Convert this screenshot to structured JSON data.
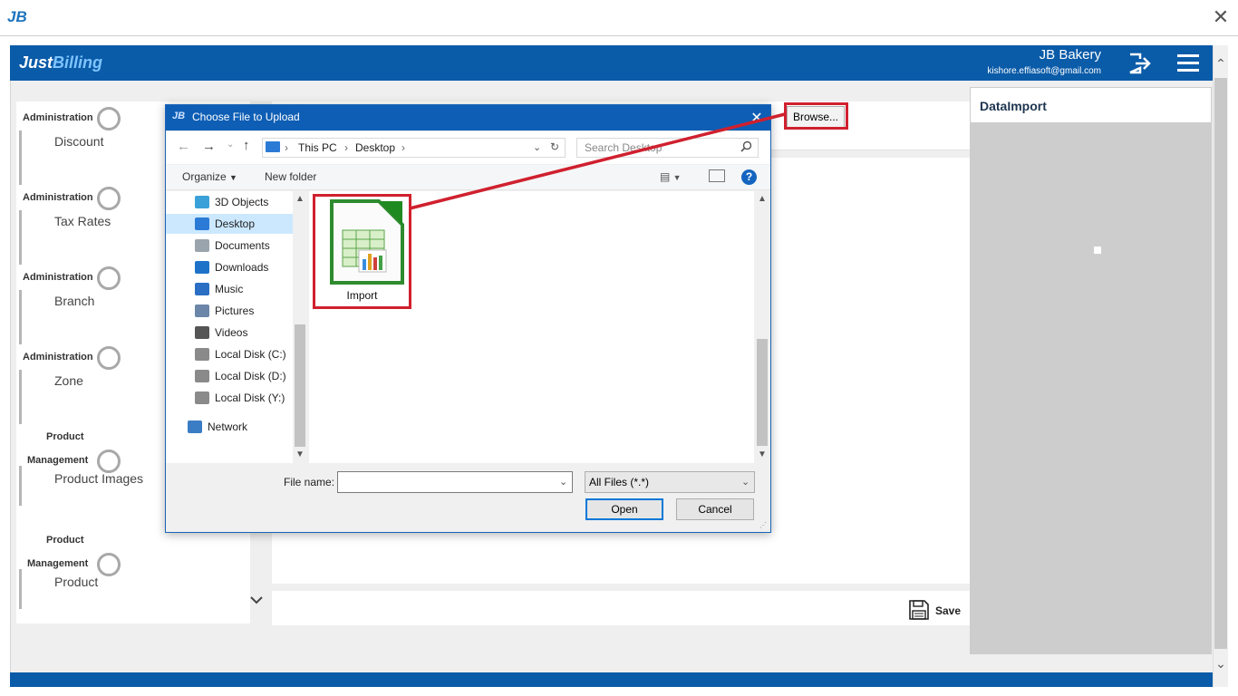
{
  "window": {
    "logo_text": "JB",
    "close_glyph": "✕"
  },
  "header": {
    "brand_part1": "Just",
    "brand_part2": "Billing",
    "company": "JB Bakery",
    "email": "kishore.effiasoft@gmail.com",
    "logout_icon": "logout-icon",
    "menu_icon": "hamburger-menu-icon"
  },
  "sidebar": {
    "items": [
      {
        "category_lines": [
          "Administration"
        ],
        "label": "Discount"
      },
      {
        "category_lines": [
          "Administration"
        ],
        "label": "Tax Rates"
      },
      {
        "category_lines": [
          "Administration"
        ],
        "label": "Branch"
      },
      {
        "category_lines": [
          "Administration"
        ],
        "label": "Zone"
      },
      {
        "category_lines": [
          "Product",
          "Management"
        ],
        "label": "Product Images"
      },
      {
        "category_lines": [
          "Product",
          "Management"
        ],
        "label": "Product"
      }
    ]
  },
  "main": {
    "browse_label": "Browse...",
    "save_label": "Save"
  },
  "right_panel": {
    "title": "DataImport"
  },
  "dialog": {
    "title": "Choose File to Upload",
    "breadcrumb": [
      "This PC",
      "Desktop"
    ],
    "search_placeholder": "Search Desktop",
    "organize_label": "Organize",
    "new_folder_label": "New folder",
    "nav_items": [
      {
        "label": "3D Objects",
        "icon": "3d-objects-icon",
        "color": "#3aa0d8"
      },
      {
        "label": "Desktop",
        "icon": "desktop-icon",
        "color": "#2b7bd6"
      },
      {
        "label": "Documents",
        "icon": "documents-icon",
        "color": "#9aa4ad"
      },
      {
        "label": "Downloads",
        "icon": "downloads-icon",
        "color": "#1e73c9"
      },
      {
        "label": "Music",
        "icon": "music-icon",
        "color": "#2a6fc4"
      },
      {
        "label": "Pictures",
        "icon": "pictures-icon",
        "color": "#6b86a8"
      },
      {
        "label": "Videos",
        "icon": "videos-icon",
        "color": "#555555"
      },
      {
        "label": "Local Disk (C:)",
        "icon": "drive-icon",
        "color": "#8a8a8a"
      },
      {
        "label": "Local Disk (D:)",
        "icon": "drive-icon",
        "color": "#8a8a8a"
      },
      {
        "label": "Local Disk (Y:)",
        "icon": "drive-icon",
        "color": "#8a8a8a"
      },
      {
        "label": "Network",
        "icon": "network-icon",
        "color": "#3b7dc4"
      }
    ],
    "selected_nav": "Desktop",
    "file": {
      "name": "Import",
      "icon": "spreadsheet-file-icon"
    },
    "filename_label": "File name:",
    "filename_value": "",
    "filetype_value": "All Files (*.*)",
    "open_label": "Open",
    "cancel_label": "Cancel"
  },
  "colors": {
    "brand_blue": "#0a5ba8",
    "highlight_red": "#d0202e",
    "dialog_blue": "#0e5eb5"
  }
}
